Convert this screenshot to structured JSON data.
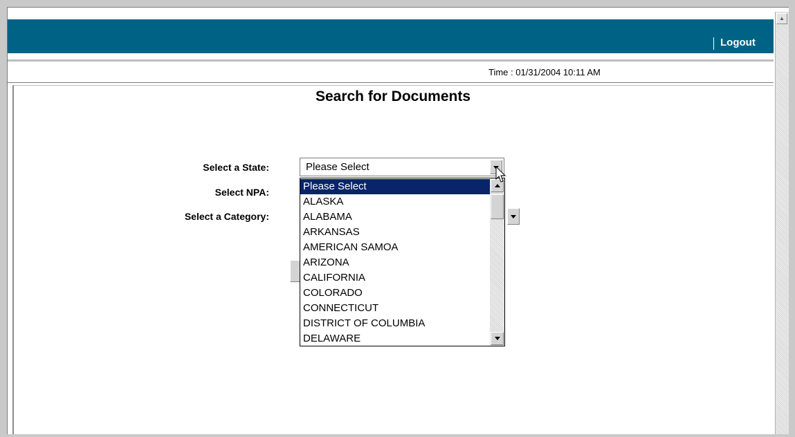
{
  "header": {
    "logout_label": "Logout",
    "bar_color": "#006385"
  },
  "status": {
    "time_text": "Time : 01/31/2004 10:11 AM"
  },
  "page": {
    "title": "Search for Documents"
  },
  "form": {
    "state_label": "Select a State:",
    "npa_label": "Select NPA:",
    "category_label": "Select a Category:",
    "state_select": {
      "selected_value": "Please Select",
      "expanded": true,
      "options": [
        "Please Select",
        "ALASKA",
        "ALABAMA",
        "ARKANSAS",
        "AMERICAN SAMOA",
        "ARIZONA",
        "CALIFORNIA",
        "COLORADO",
        "CONNECTICUT",
        "DISTRICT OF COLUMBIA",
        "DELAWARE"
      ],
      "highlight_color": "#0a246a"
    }
  }
}
